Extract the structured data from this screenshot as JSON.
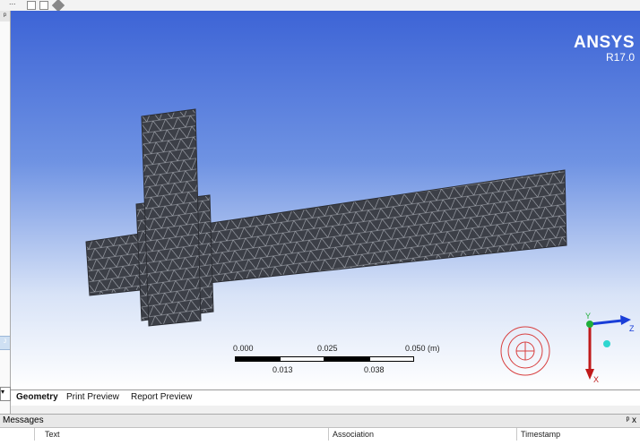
{
  "toolbar": {
    "partial_label": "...",
    "icons": [
      "page-icon",
      "page-icon",
      "diamond-icon"
    ]
  },
  "left_panel": {
    "pin_glyph": "ᵖ",
    "selected_glyph": "ᴊ",
    "dropdown_glyph": "▾"
  },
  "viewport": {
    "brand_name": "ANSYS",
    "brand_version": "R17.0",
    "scale": {
      "top_labels": [
        "0.000",
        "0.025",
        "0.050 (m)"
      ],
      "bottom_labels": [
        "0.013",
        "0.038"
      ]
    },
    "triad": {
      "y_label": "Y",
      "z_label": "Z",
      "x_label": "X"
    }
  },
  "tabs": [
    {
      "label": "Geometry",
      "active": true
    },
    {
      "label": "Print Preview",
      "active": false
    },
    {
      "label": "Report Preview",
      "active": false
    }
  ],
  "messages": {
    "title": "Messages",
    "pin_close": "ᵖ x",
    "columns": [
      "Text",
      "Association",
      "Timestamp"
    ]
  },
  "colors": {
    "viewport_top": "#3d64d6",
    "viewport_bottom": "#ffffff",
    "mesh_fill": "#3c3f47",
    "compass": "#d84040",
    "axis_y": "#1fae3a",
    "axis_z": "#1a3ed8",
    "axis_x": "#c01a1a"
  }
}
